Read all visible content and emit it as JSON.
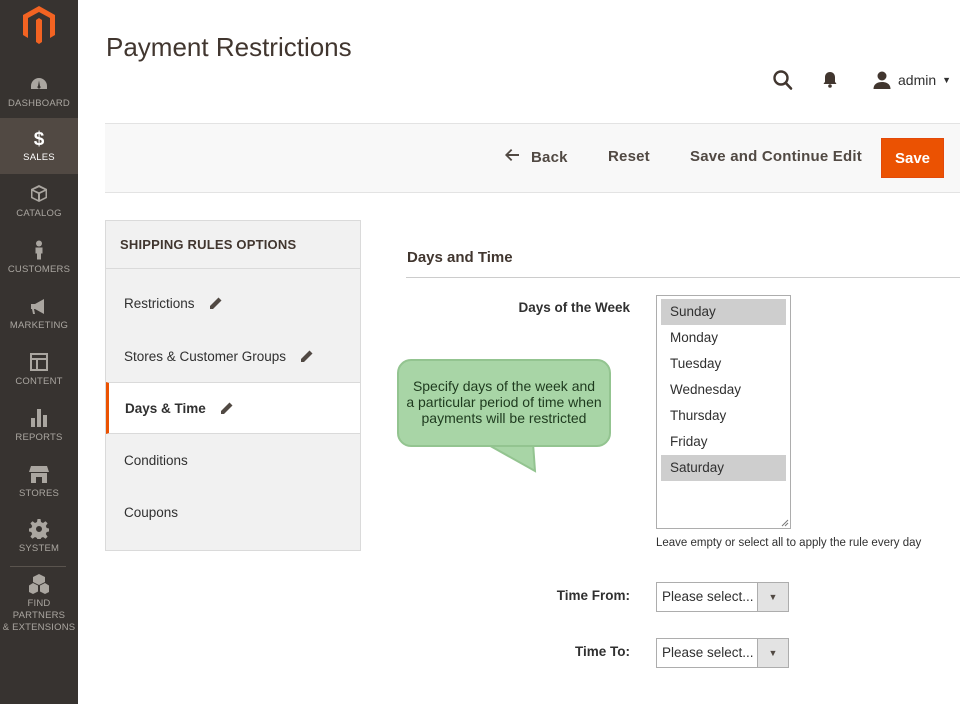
{
  "sidebar": {
    "items": [
      {
        "label": "DASHBOARD",
        "icon": "speedometer-icon"
      },
      {
        "label": "SALES",
        "icon": "dollar-icon"
      },
      {
        "label": "CATALOG",
        "icon": "box-icon"
      },
      {
        "label": "CUSTOMERS",
        "icon": "person-icon"
      },
      {
        "label": "MARKETING",
        "icon": "megaphone-icon"
      },
      {
        "label": "CONTENT",
        "icon": "layout-icon"
      },
      {
        "label": "REPORTS",
        "icon": "bar-chart-icon"
      },
      {
        "label": "STORES",
        "icon": "storefront-icon"
      },
      {
        "label": "SYSTEM",
        "icon": "gear-icon"
      },
      {
        "label_line1": "FIND PARTNERS",
        "label_line2": "& EXTENSIONS",
        "icon": "cubes-icon"
      }
    ],
    "active": "SALES"
  },
  "header": {
    "title": "Payment Restrictions",
    "user": "admin"
  },
  "toolbar": {
    "back_label": "Back",
    "reset_label": "Reset",
    "save_continue_label": "Save and Continue Edit",
    "save_label": "Save"
  },
  "tabs": {
    "title": "SHIPPING RULES OPTIONS",
    "items": [
      {
        "label": "Restrictions"
      },
      {
        "label": "Stores & Customer Groups"
      },
      {
        "label": "Days & Time"
      },
      {
        "label": "Conditions"
      },
      {
        "label": "Coupons"
      }
    ],
    "active": "Days & Time"
  },
  "section": {
    "title": "Days and Time",
    "days_label": "Days of the Week",
    "days": [
      {
        "label": "Sunday",
        "selected": true
      },
      {
        "label": "Monday",
        "selected": false
      },
      {
        "label": "Tuesday",
        "selected": false
      },
      {
        "label": "Wednesday",
        "selected": false
      },
      {
        "label": "Thursday",
        "selected": false
      },
      {
        "label": "Friday",
        "selected": false
      },
      {
        "label": "Saturday",
        "selected": true
      }
    ],
    "days_hint": "Leave empty or select all to apply the rule every day",
    "time_from_label": "Time From:",
    "time_from_value": "Please select...",
    "time_to_label": "Time To:",
    "time_to_value": "Please select..."
  },
  "callout": {
    "line1": "Specify days of the week and",
    "line2": "a particular period of time when",
    "line3": "payments will be restricted"
  },
  "colors": {
    "sidebar_bg": "#373330",
    "sidebar_active": "#514943",
    "accent": "#eb5202",
    "callout_bg": "#a8d5a6"
  }
}
